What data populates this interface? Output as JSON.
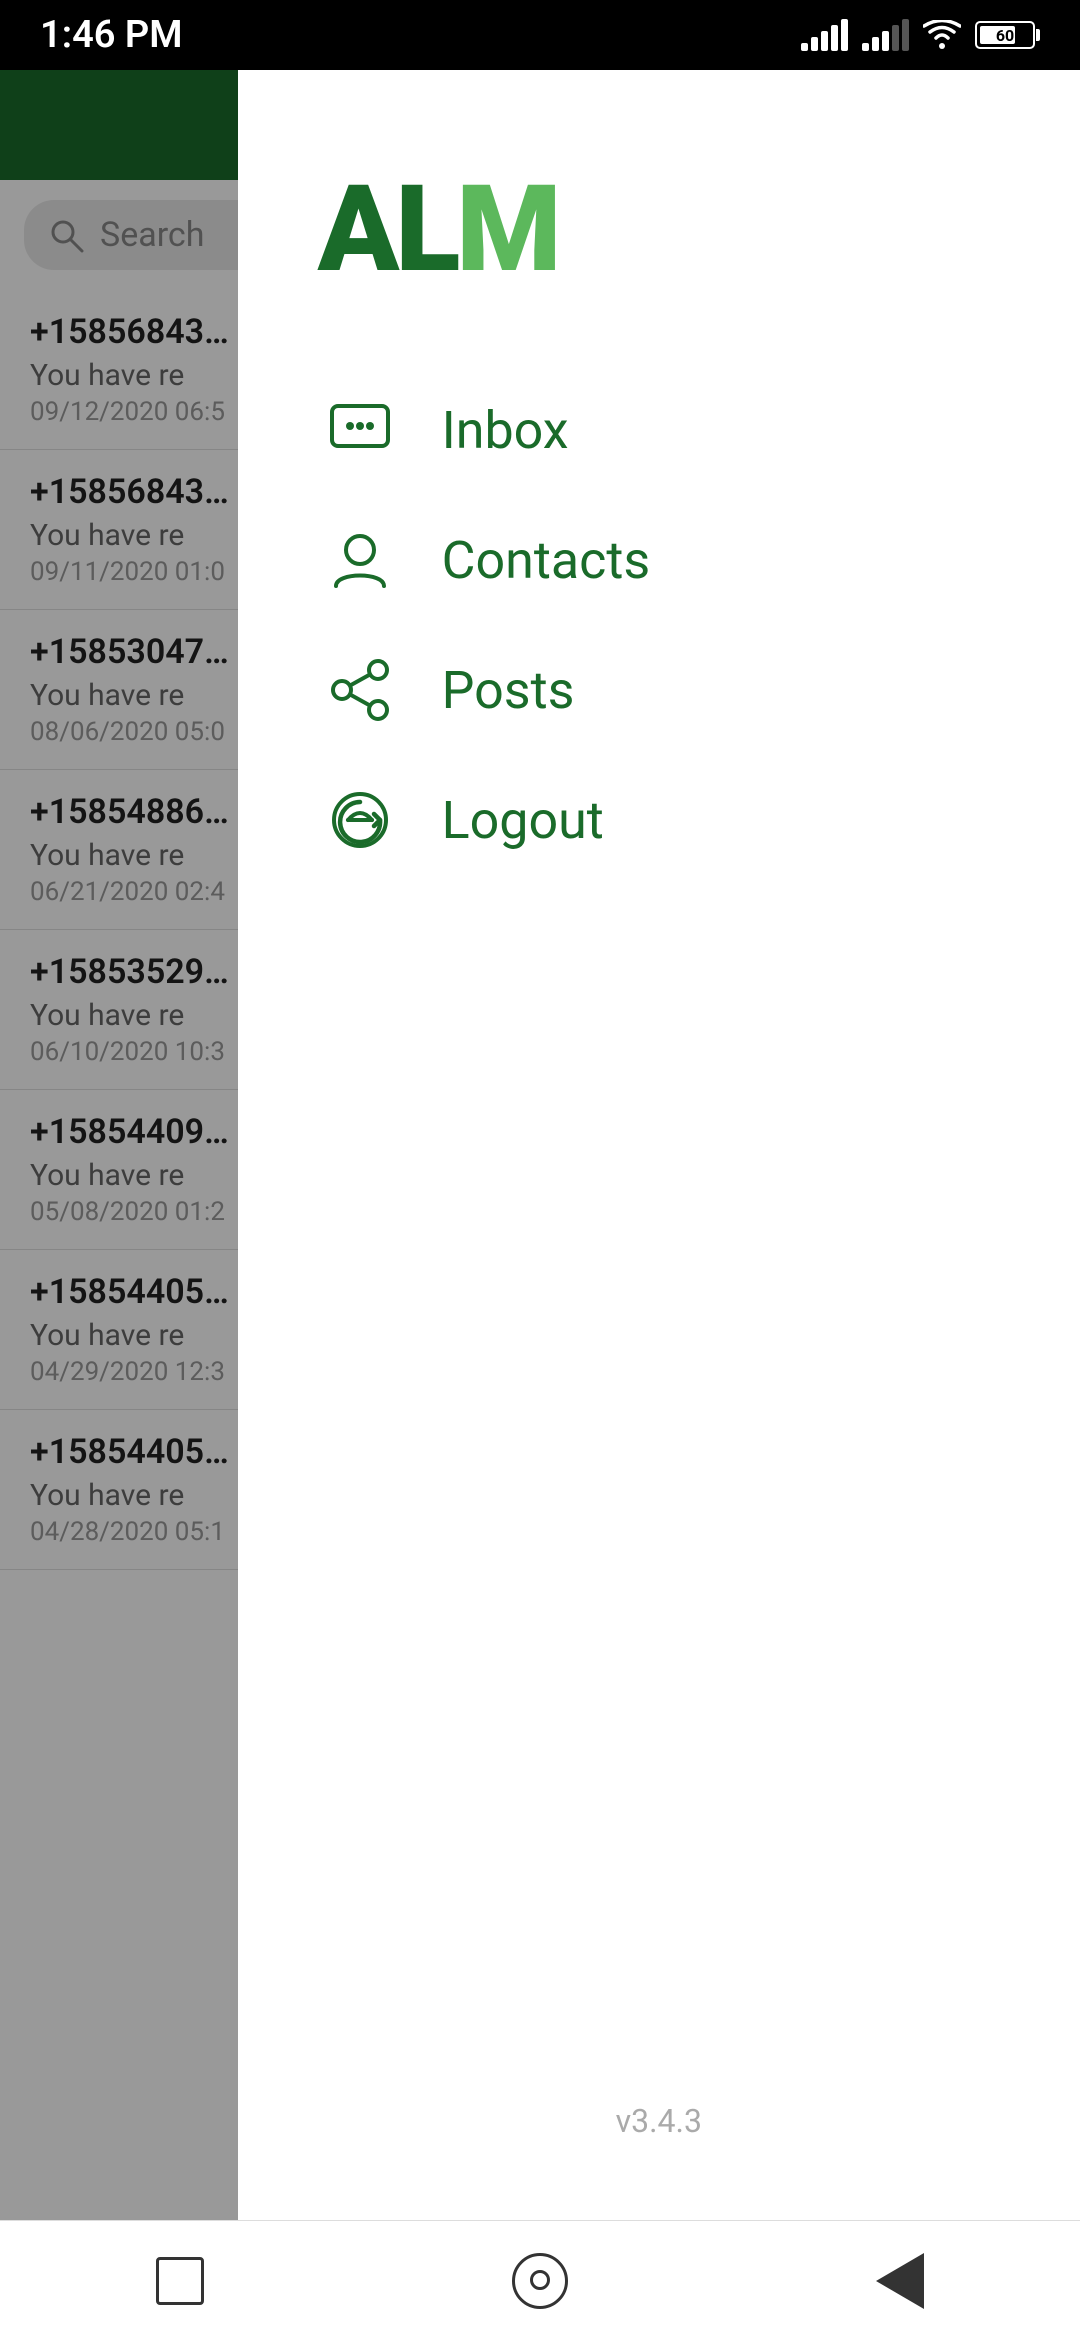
{
  "statusBar": {
    "time": "1:46 PM",
    "batteryLevel": "60"
  },
  "header": {
    "backgroundColor": "#1a6b2a"
  },
  "search": {
    "placeholder": "Search"
  },
  "inboxItems": [
    {
      "phone": "+15856843",
      "preview": "You have re",
      "date": "09/12/2020 06:5"
    },
    {
      "phone": "+15856843",
      "preview": "You have re",
      "date": "09/11/2020 01:0"
    },
    {
      "phone": "+15853047",
      "preview": "You have re",
      "date": "08/06/2020 05:0"
    },
    {
      "phone": "+15854886",
      "preview": "You have re",
      "date": "06/21/2020 02:4"
    },
    {
      "phone": "+15853529",
      "preview": "You have re",
      "date": "06/10/2020 10:3"
    },
    {
      "phone": "+15854409",
      "preview": "You have re",
      "date": "05/08/2020 01:2"
    },
    {
      "phone": "+15854405",
      "preview": "You have re",
      "date": "04/29/2020 12:3"
    },
    {
      "phone": "+15854405",
      "preview": "You have re",
      "date": "04/28/2020 05:1"
    }
  ],
  "drawer": {
    "logo": {
      "al": "AL",
      "m": "M"
    },
    "menuItems": [
      {
        "id": "inbox",
        "label": "Inbox",
        "iconType": "chat"
      },
      {
        "id": "contacts",
        "label": "Contacts",
        "iconType": "person"
      },
      {
        "id": "posts",
        "label": "Posts",
        "iconType": "share"
      },
      {
        "id": "logout",
        "label": "Logout",
        "iconType": "logout"
      }
    ],
    "version": "v3.4.3"
  },
  "bottomNav": {
    "items": [
      "square",
      "circle",
      "triangle"
    ]
  }
}
